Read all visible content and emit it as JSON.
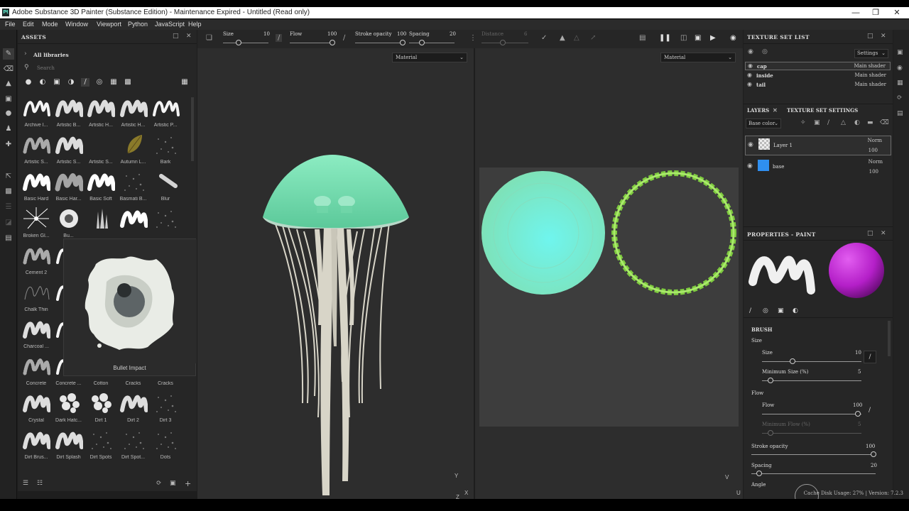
{
  "window": {
    "title": "Adobe Substance 3D Painter (Substance Edition) - Maintenance Expired - Untitled (Read only)",
    "app_icon": "Pt"
  },
  "menu": [
    "File",
    "Edit",
    "Mode",
    "Window",
    "Viewport",
    "Python",
    "JavaScript",
    "Help"
  ],
  "assets": {
    "title": "ASSETS",
    "library": "All libraries",
    "search_placeholder": "Search",
    "items": [
      {
        "label": "Archive I...",
        "kind": "stroke"
      },
      {
        "label": "Artistic B...",
        "kind": "stroke-rough"
      },
      {
        "label": "Artistic H...",
        "kind": "stroke-rough"
      },
      {
        "label": "Artistic H...",
        "kind": "stroke-rough"
      },
      {
        "label": "Artistic P...",
        "kind": "stroke"
      },
      {
        "label": "Artistic S...",
        "kind": "stroke-dots"
      },
      {
        "label": "Artistic S...",
        "kind": "stroke-rough"
      },
      {
        "label": "Artistic S...",
        "kind": "blank"
      },
      {
        "label": "Autumn L...",
        "kind": "leaf"
      },
      {
        "label": "Bark",
        "kind": "texture"
      },
      {
        "label": "Basic Hard",
        "kind": "stroke-bold"
      },
      {
        "label": "Basic Har...",
        "kind": "stroke-soft"
      },
      {
        "label": "Basic Soft",
        "kind": "stroke-bold"
      },
      {
        "label": "Basmati B...",
        "kind": "texture"
      },
      {
        "label": "Blur",
        "kind": "blur"
      },
      {
        "label": "Broken Gl...",
        "kind": "glass"
      },
      {
        "label": "Bu...",
        "kind": "bullet"
      },
      {
        "label": "",
        "kind": "spikes"
      },
      {
        "label": "",
        "kind": "stroke-bold"
      },
      {
        "label": "",
        "kind": "texture"
      },
      {
        "label": "Cement 2",
        "kind": "stroke-dots"
      },
      {
        "label": "Ch",
        "kind": "stroke"
      },
      {
        "label": "",
        "kind": "blank"
      },
      {
        "label": "",
        "kind": "blank"
      },
      {
        "label": "",
        "kind": "blank"
      },
      {
        "label": "Chalk Thin",
        "kind": "thin"
      },
      {
        "label": "Ch",
        "kind": "stroke"
      },
      {
        "label": "",
        "kind": "blank"
      },
      {
        "label": "",
        "kind": "blank"
      },
      {
        "label": "",
        "kind": "blank"
      },
      {
        "label": "Charcoal ...",
        "kind": "stroke-rough"
      },
      {
        "label": "Ch",
        "kind": "stroke"
      },
      {
        "label": "",
        "kind": "blank"
      },
      {
        "label": "",
        "kind": "blank"
      },
      {
        "label": "",
        "kind": "blank"
      },
      {
        "label": "Concrete",
        "kind": "stroke-dots"
      },
      {
        "label": "Concrete ...",
        "kind": "stroke"
      },
      {
        "label": "Cotton",
        "kind": "blank"
      },
      {
        "label": "Cracks",
        "kind": "blank"
      },
      {
        "label": "Cracks",
        "kind": "blank"
      },
      {
        "label": "Crystal",
        "kind": "stroke-rough"
      },
      {
        "label": "Dark Hatc...",
        "kind": "texture-light"
      },
      {
        "label": "Dirt 1",
        "kind": "texture-light"
      },
      {
        "label": "Dirt 2",
        "kind": "stroke-rough"
      },
      {
        "label": "Dirt 3",
        "kind": "texture"
      },
      {
        "label": "Dirt Brus...",
        "kind": "stroke-rough"
      },
      {
        "label": "Dirt Splash",
        "kind": "stroke-rough"
      },
      {
        "label": "Dirt Spots",
        "kind": "texture"
      },
      {
        "label": "Dirt Spot...",
        "kind": "texture"
      },
      {
        "label": "Dots",
        "kind": "texture"
      }
    ],
    "tooltip": "Bullet Impact"
  },
  "toolbar": {
    "size_label": "Size",
    "size_value": "10",
    "flow_label": "Flow",
    "flow_value": "100",
    "opacity_label": "Stroke opacity",
    "opacity_value": "100",
    "spacing_label": "Spacing",
    "spacing_value": "20",
    "distance_label": "Distance",
    "distance_value": "6"
  },
  "viewport3d": {
    "material": "Material",
    "axis_y": "Y",
    "axis_x": "X",
    "axis_z": "Z"
  },
  "viewport2d": {
    "material": "Material",
    "axis_v": "V",
    "axis_u": "U"
  },
  "colors": {
    "cap": "#7fe0b4",
    "tentacle": "#d8d5c8",
    "bg_viewport": "#2d2d2d",
    "ring": "#7ecb3f",
    "accent_purple": "#b41fc8"
  },
  "texture_sets": {
    "title": "TEXTURE SET LIST",
    "settings": "Settings",
    "items": [
      {
        "name": "cap",
        "shader": "Main shader"
      },
      {
        "name": "inside",
        "shader": "Main shader"
      },
      {
        "name": "tail",
        "shader": "Main shader"
      }
    ]
  },
  "layers": {
    "tab1": "LAYERS",
    "tab2": "TEXTURE SET SETTINGS",
    "channel": "Base color",
    "items": [
      {
        "name": "Layer 1",
        "blend": "Norm",
        "opacity": "100"
      },
      {
        "name": "base",
        "blend": "Norm",
        "opacity": "100"
      }
    ]
  },
  "properties": {
    "title": "PROPERTIES - PAINT",
    "section": "BRUSH",
    "size_group": "Size",
    "size_label": "Size",
    "size_value": "10",
    "minsize_label": "Minimum Size (%)",
    "minsize_value": "5",
    "flow_group": "Flow",
    "flow_label": "Flow",
    "flow_value": "100",
    "minflow_label": "Minimum Flow (%)",
    "minflow_value": "5",
    "opacity_label": "Stroke opacity",
    "opacity_value": "100",
    "spacing_label": "Spacing",
    "spacing_value": "20",
    "angle_label": "Angle"
  },
  "status": {
    "text": "Cache Disk Usage:   27% | Version: 7.2.3"
  }
}
